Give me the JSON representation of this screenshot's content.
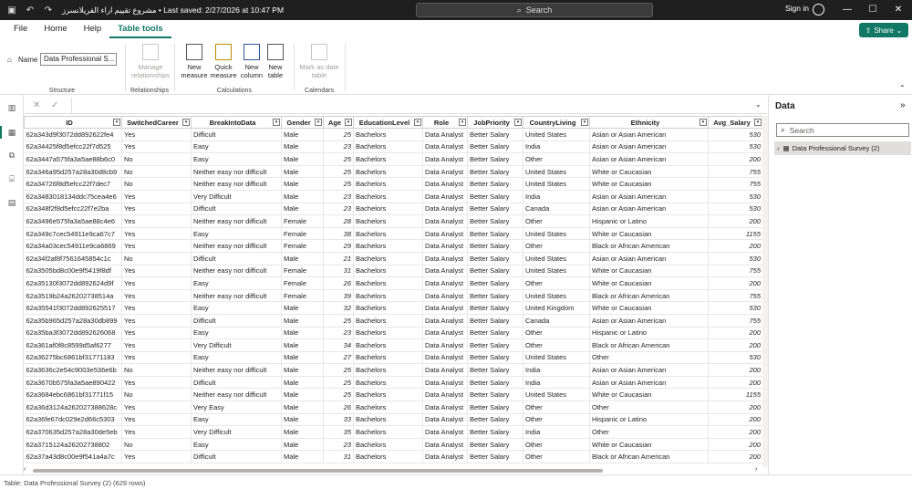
{
  "titlebar": {
    "title": "مشروع تقييم اراء الفريلانسرز • Last saved: 2/27/2026 at 10:47 PM",
    "search_placeholder": "Search",
    "signin": "Sign in"
  },
  "menu": {
    "file": "File",
    "home": "Home",
    "help": "Help",
    "table_tools": "Table tools",
    "share": "Share"
  },
  "ribbon": {
    "name_label": "Name",
    "name_value": "Data Professional S...",
    "structure": "Structure",
    "manage_relationships": "Manage relationships",
    "relationships": "Relationships",
    "new_measure": "New measure",
    "quick_measure": "Quick measure",
    "new_column": "New column",
    "new_table": "New table",
    "calculations": "Calculations",
    "mark_as_date_table": "Mark as date table",
    "calendars": "Calendars"
  },
  "table": {
    "columns": [
      "ID",
      "SwitchedCareer",
      "BreakIntoData",
      "Gender",
      "Age",
      "EducationLevel",
      "Role",
      "JobPriority",
      "CountryLiving",
      "Ethnicity",
      "Avg_Salary"
    ],
    "rows": [
      [
        "62a343d9f3072dd892622fe4",
        "Yes",
        "Difficult",
        "Male",
        "25",
        "Bachelors",
        "Data Analyst",
        "Better Salary",
        "United States",
        "Asian or Asian American",
        "530"
      ],
      [
        "62a34425f8d5efcc22f7d525",
        "Yes",
        "Easy",
        "Male",
        "23",
        "Bachelors",
        "Data Analyst",
        "Better Salary",
        "India",
        "Asian or Asian American",
        "530"
      ],
      [
        "62a3447a575fa3a5ae88b6c0",
        "No",
        "Easy",
        "Male",
        "25",
        "Bachelors",
        "Data Analyst",
        "Better Salary",
        "Other",
        "Asian or Asian American",
        "200"
      ],
      [
        "62a346a95d257a28a30d8cb9",
        "No",
        "Neither easy nor difficult",
        "Male",
        "25",
        "Bachelors",
        "Data Analyst",
        "Better Salary",
        "United States",
        "White or Caucasian",
        "755"
      ],
      [
        "62a34726f8d5efcc22f7dec7",
        "No",
        "Neither easy nor difficult",
        "Male",
        "25",
        "Bachelors",
        "Data Analyst",
        "Better Salary",
        "United States",
        "White or Caucasian",
        "755"
      ],
      [
        "62a3483018134ddc75cea4e6",
        "Yes",
        "Very Difficult",
        "Male",
        "23",
        "Bachelors",
        "Data Analyst",
        "Better Salary",
        "India",
        "Asian or Asian American",
        "530"
      ],
      [
        "62a348f2f8d5efcc22f7e2ba",
        "Yes",
        "Difficult",
        "Male",
        "23",
        "Bachelors",
        "Data Analyst",
        "Better Salary",
        "Canada",
        "Asian or Asian American",
        "530"
      ],
      [
        "62a3496e575fa3a5ae88c4e6",
        "Yes",
        "Neither easy nor difficult",
        "Female",
        "28",
        "Bachelors",
        "Data Analyst",
        "Better Salary",
        "Other",
        "Hispanic or Latino",
        "200"
      ],
      [
        "62a349c7cec54911e9ca67c7",
        "Yes",
        "Easy",
        "Female",
        "38",
        "Bachelors",
        "Data Analyst",
        "Better Salary",
        "United States",
        "White or Caucasian",
        "1155"
      ],
      [
        "62a34a03cec54911e9ca6869",
        "Yes",
        "Neither easy nor difficult",
        "Female",
        "29",
        "Bachelors",
        "Data Analyst",
        "Better Salary",
        "Other",
        "Black or African American",
        "200"
      ],
      [
        "62a34f2af8f7561645854c1c",
        "No",
        "Difficult",
        "Male",
        "21",
        "Bachelors",
        "Data Analyst",
        "Better Salary",
        "United States",
        "Asian or Asian American",
        "530"
      ],
      [
        "62a3505bd8c00e9f5419f8df",
        "Yes",
        "Neither easy nor difficult",
        "Female",
        "31",
        "Bachelors",
        "Data Analyst",
        "Better Salary",
        "United States",
        "White or Caucasian",
        "755"
      ],
      [
        "62a35130f3072dd892624d9f",
        "Yes",
        "Easy",
        "Female",
        "26",
        "Bachelors",
        "Data Analyst",
        "Better Salary",
        "Other",
        "White or Caucasian",
        "200"
      ],
      [
        "62a3519b24a26202738514a",
        "Yes",
        "Neither easy nor difficult",
        "Female",
        "39",
        "Bachelors",
        "Data Analyst",
        "Better Salary",
        "United States",
        "Black or African American",
        "755"
      ],
      [
        "62a35541f3072dd892625517",
        "Yes",
        "Easy",
        "Male",
        "32",
        "Bachelors",
        "Data Analyst",
        "Better Salary",
        "United Kingdom",
        "White or Caucasian",
        "530"
      ],
      [
        "62a35b965d257a28a30db899",
        "Yes",
        "Difficult",
        "Male",
        "25",
        "Bachelors",
        "Data Analyst",
        "Better Salary",
        "Canada",
        "Asian or Asian American",
        "755"
      ],
      [
        "62a35ba3f3072dd892626068",
        "Yes",
        "Easy",
        "Male",
        "23",
        "Bachelors",
        "Data Analyst",
        "Better Salary",
        "Other",
        "Hispanic or Latino",
        "200"
      ],
      [
        "62a361af0f8c8599d5af6277",
        "Yes",
        "Very Difficult",
        "Male",
        "34",
        "Bachelors",
        "Data Analyst",
        "Better Salary",
        "Other",
        "Black or African American",
        "200"
      ],
      [
        "62a36275bc6861bf31771183",
        "Yes",
        "Easy",
        "Male",
        "27",
        "Bachelors",
        "Data Analyst",
        "Better Salary",
        "United States",
        "Other",
        "530"
      ],
      [
        "62a3636c2e54c9003e536e6b",
        "No",
        "Neither easy nor difficult",
        "Male",
        "25",
        "Bachelors",
        "Data Analyst",
        "Better Salary",
        "India",
        "Asian or Asian American",
        "200"
      ],
      [
        "62a3670b575fa3a5ae890422",
        "Yes",
        "Difficult",
        "Male",
        "25",
        "Bachelors",
        "Data Analyst",
        "Better Salary",
        "India",
        "Asian or Asian American",
        "200"
      ],
      [
        "62a3684ebc6861bf31771f15",
        "No",
        "Neither easy nor difficult",
        "Male",
        "25",
        "Bachelors",
        "Data Analyst",
        "Better Salary",
        "United States",
        "White or Caucasian",
        "1155"
      ],
      [
        "62a36d3124a262027388628c",
        "Yes",
        "Very Easy",
        "Male",
        "26",
        "Bachelors",
        "Data Analyst",
        "Better Salary",
        "Other",
        "Other",
        "200"
      ],
      [
        "62a36fe67dc029e2d66c5303",
        "Yes",
        "Easy",
        "Male",
        "33",
        "Bachelors",
        "Data Analyst",
        "Better Salary",
        "Other",
        "Hispanic or Latino",
        "200"
      ],
      [
        "62a370635d257a28a30de5eb",
        "Yes",
        "Very Difficult",
        "Male",
        "35",
        "Bachelors",
        "Data Analyst",
        "Better Salary",
        "India",
        "Other",
        "200"
      ],
      [
        "62a3715124a26202738802",
        "No",
        "Easy",
        "Male",
        "23",
        "Bachelors",
        "Data Analyst",
        "Better Salary",
        "Other",
        "White or Caucasian",
        "200"
      ],
      [
        "62a37a43d8c00e9f541a4a7c",
        "Yes",
        "Difficult",
        "Male",
        "31",
        "Bachelors",
        "Data Analyst",
        "Better Salary",
        "Other",
        "Black or African American",
        "200"
      ]
    ]
  },
  "data_panel": {
    "title": "Data",
    "search_placeholder": "Search",
    "table_name": "Data Professional Survey (2)"
  },
  "status": {
    "text": "Table: Data Professional Survey (2) (629 rows)"
  }
}
